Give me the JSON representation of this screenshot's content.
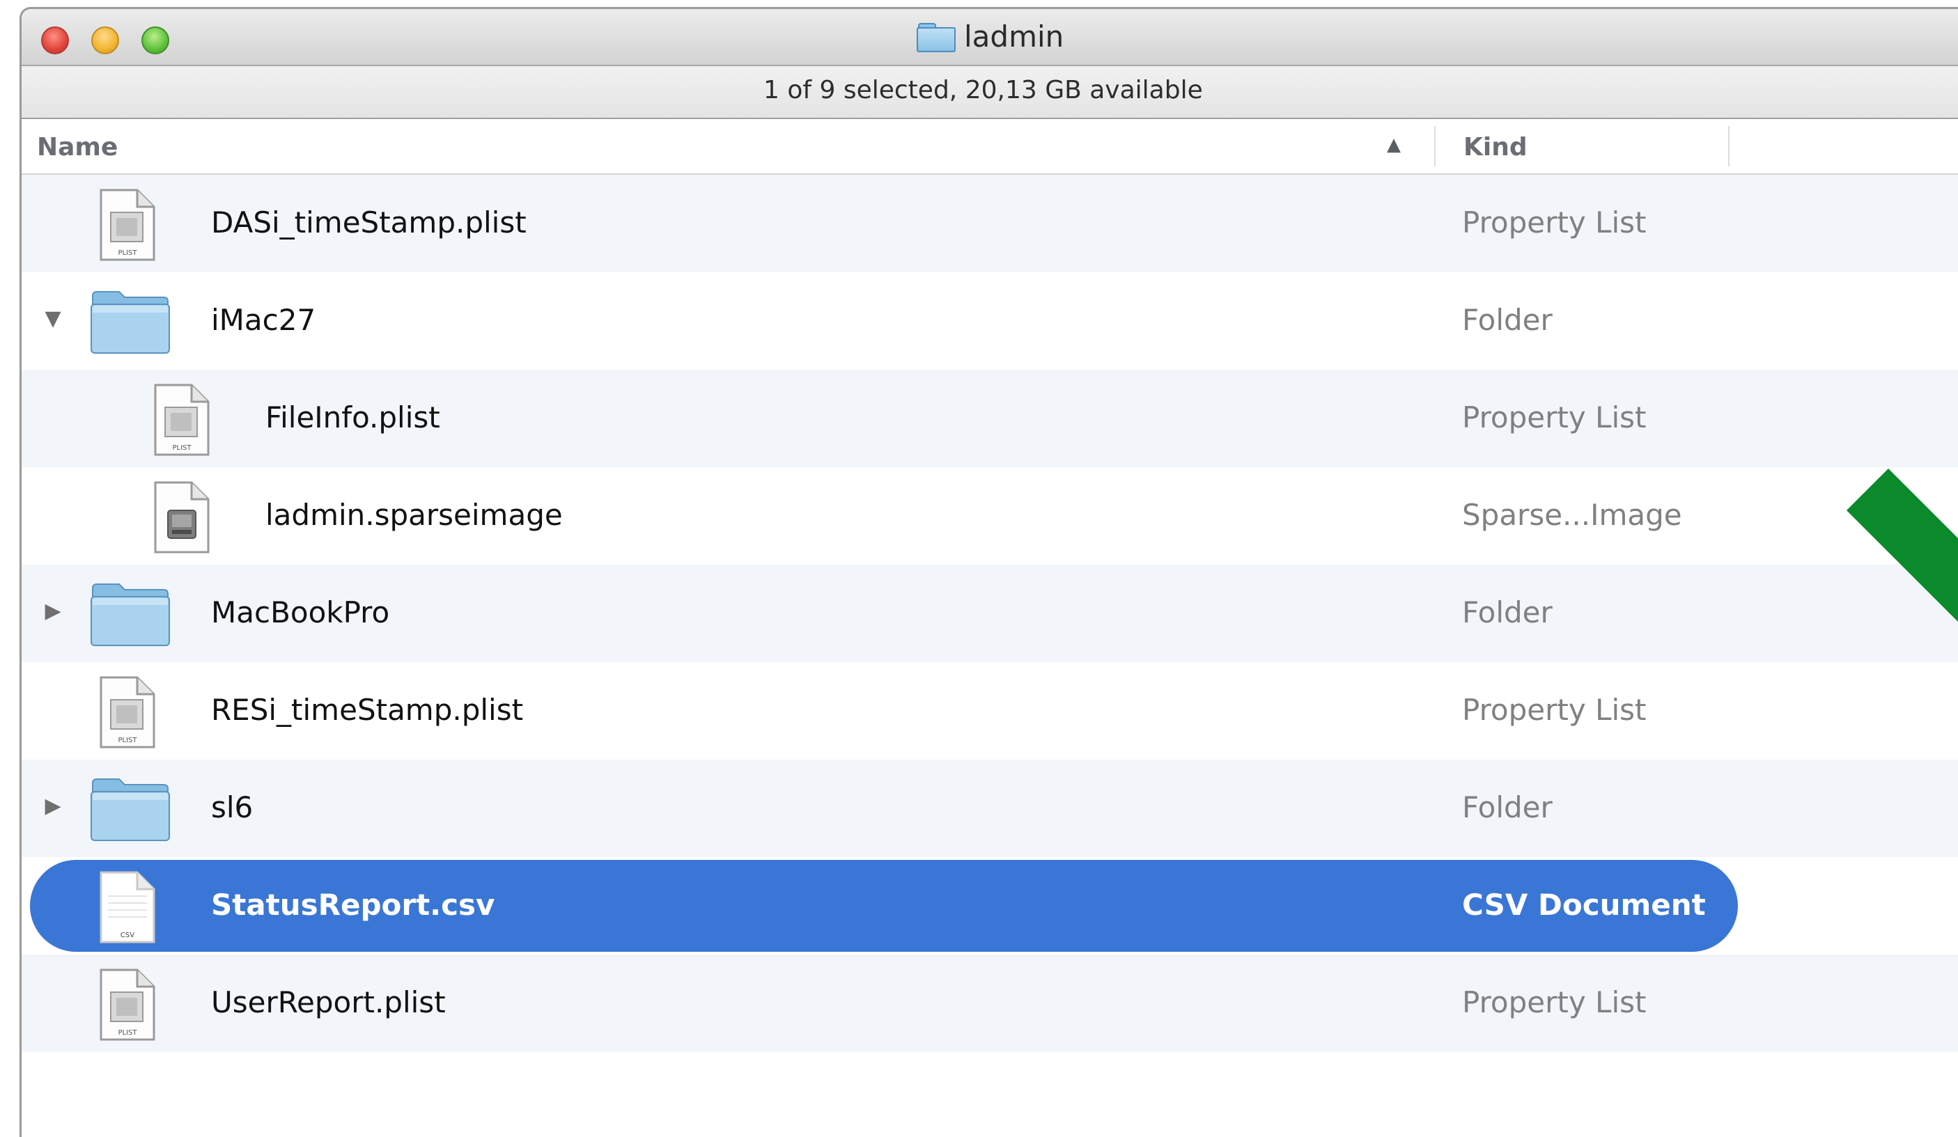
{
  "window": {
    "title": "ladmin",
    "status": "1 of 9 selected, 20,13 GB available"
  },
  "columns": {
    "name": "Name",
    "kind": "Kind",
    "sort_indicator": "▲"
  },
  "rows": [
    {
      "name": "DASi_timeStamp.plist",
      "kind": "Property List",
      "icon": "plist-document-icon",
      "icon_label": "PLIST"
    },
    {
      "name": "iMac27",
      "kind": "Folder",
      "icon": "folder-icon",
      "disclosure": "▼"
    },
    {
      "name": "FileInfo.plist",
      "kind": "Property List",
      "icon": "plist-document-icon",
      "icon_label": "PLIST"
    },
    {
      "name": "ladmin.sparseimage",
      "kind": "Sparse...Image",
      "icon": "disk-image-icon"
    },
    {
      "name": "MacBookPro",
      "kind": "Folder",
      "icon": "folder-icon",
      "disclosure": "▶"
    },
    {
      "name": "RESi_timeStamp.plist",
      "kind": "Property List",
      "icon": "plist-document-icon",
      "icon_label": "PLIST"
    },
    {
      "name": "sl6",
      "kind": "Folder",
      "icon": "folder-icon",
      "disclosure": "▶"
    },
    {
      "name": "StatusReport.csv",
      "kind": "CSV Document",
      "icon": "csv-document-icon",
      "icon_label": "CSV",
      "selected": true
    },
    {
      "name": "UserReport.plist",
      "kind": "Property List",
      "icon": "plist-document-icon",
      "icon_label": "PLIST"
    }
  ],
  "colors": {
    "selection": "#3a76d5",
    "folder": "#9ccbea",
    "annotation_arrow": "#0a8a2a"
  }
}
